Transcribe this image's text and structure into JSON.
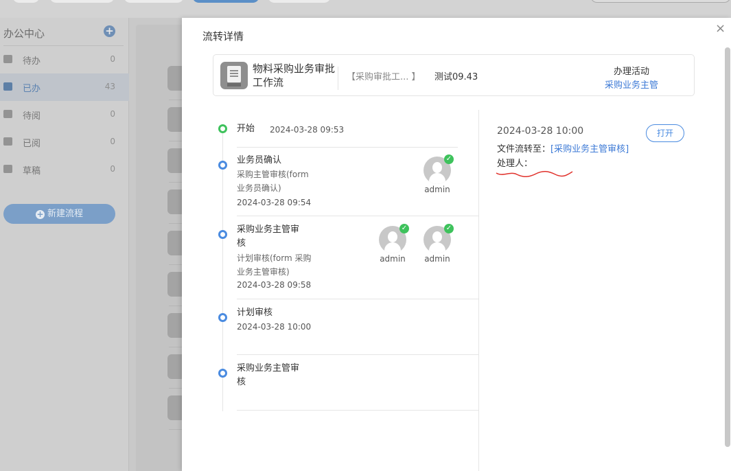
{
  "sidebar": {
    "title": "办公中心",
    "items": [
      {
        "label": "待办",
        "count": "0"
      },
      {
        "label": "已办",
        "count": "43"
      },
      {
        "label": "待阅",
        "count": "0"
      },
      {
        "label": "已阅",
        "count": "0"
      },
      {
        "label": "草稿",
        "count": "0"
      }
    ],
    "new_button": "新建流程"
  },
  "drawer": {
    "title": "流转详情",
    "close": "×",
    "summary": {
      "name": "物料采购业务审批工作流",
      "workflow": "【采购审批工...  】",
      "test": "测试09.43",
      "activity_label": "办理活动",
      "activity_value": "采购业务主管"
    },
    "timeline": [
      {
        "title": "开始",
        "time": "2024-03-28 09:53"
      },
      {
        "title": "业务员确认",
        "sub1": "采购主管审核(form",
        "sub2": "业务员确认)",
        "time": "2024-03-28 09:54",
        "users": [
          "admin"
        ]
      },
      {
        "title1": "采购业务主管审",
        "title2": "核",
        "sub1": "计划审核(form 采购",
        "sub2": "业务主管审核)",
        "time": "2024-03-28 09:58",
        "users": [
          "admin",
          "admin"
        ]
      },
      {
        "title": "计划审核",
        "time": "2024-03-28 10:00"
      },
      {
        "title1": "采购业务主管审",
        "title2": "核"
      }
    ],
    "detail": {
      "time": "2024-03-28 10:00",
      "open_button": "打开",
      "flow_label": "文件流转至：",
      "flow_target": "[采购业务主管审核]",
      "handler_label": "处理人："
    }
  }
}
